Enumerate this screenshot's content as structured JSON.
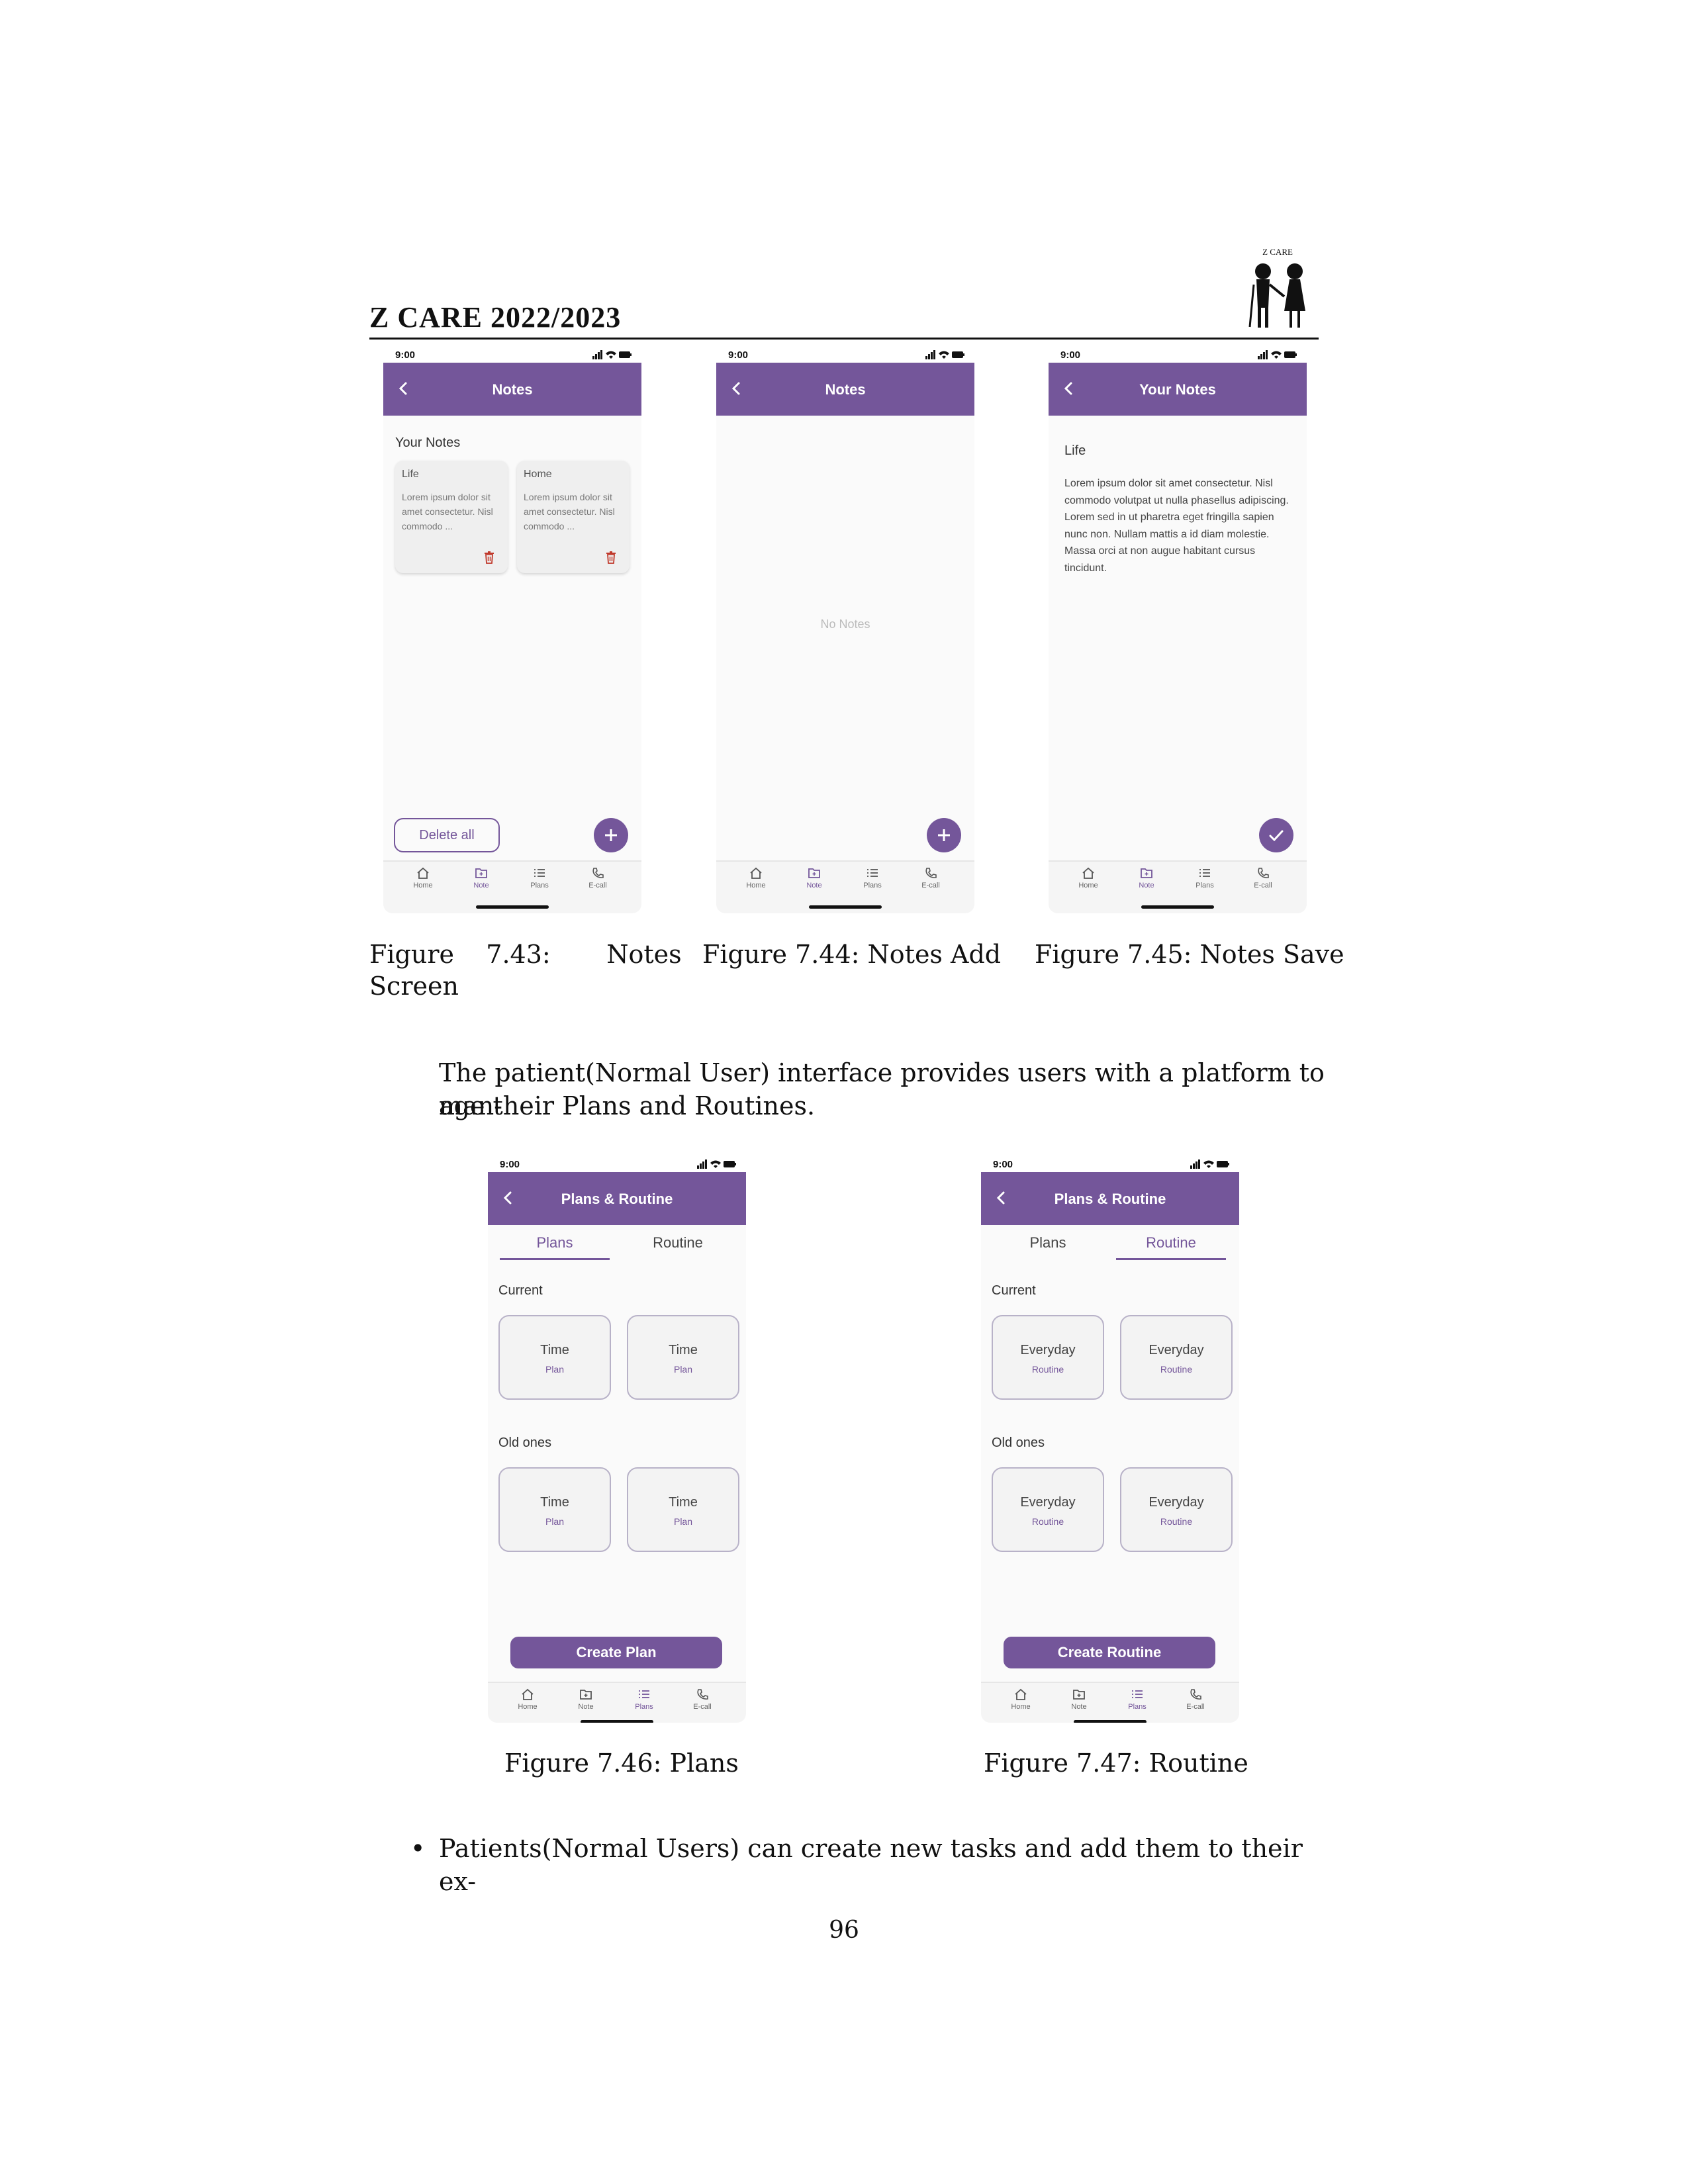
{
  "header": {
    "title": "Z CARE 2022/2023",
    "logo_text": "Z CARE"
  },
  "common": {
    "status_time": "9:00",
    "nav": [
      "Home",
      "Note",
      "Plans",
      "E-call"
    ]
  },
  "phone1": {
    "title": "Notes",
    "section": "Your Notes",
    "notes": [
      {
        "title": "Life",
        "body": "Lorem ipsum dolor sit amet consectetur. Nisl commodo ..."
      },
      {
        "title": "Home",
        "body": "Lorem ipsum dolor sit amet consectetur. Nisl commodo ..."
      }
    ],
    "delete_all": "Delete all",
    "active_nav": "Note"
  },
  "phone2": {
    "title": "Notes",
    "empty": "No Notes"
  },
  "phone3": {
    "title": "Your Notes",
    "note_title": "Life",
    "note_body": "Lorem ipsum dolor sit amet consectetur. Nisl commodo volutpat ut nulla phasellus adipiscing. Lorem sed in ut pharetra eget fringilla sapien nunc non. Nullam mattis a id diam molestie. Massa orci at non augue habitant cursus tincidunt."
  },
  "captions": {
    "c43a": "Figure    7.43:       Notes",
    "c43b": "Screen",
    "c44": "Figure 7.44: Notes Add",
    "c45": "Figure 7.45: Notes Save",
    "c46": "Figure 7.46: Plans",
    "c47": "Figure 7.47: Routine"
  },
  "paragraph": {
    "line1": "The patient(Normal User) interface provides users with a platform to man-",
    "line2": "age their Plans and Routines."
  },
  "phone4": {
    "title": "Plans & Routine",
    "tabs": [
      "Plans",
      "Routine"
    ],
    "current": "Current",
    "old": "Old ones",
    "card_title": "Time",
    "card_sub": "Plan",
    "button": "Create Plan"
  },
  "phone5": {
    "title": "Plans & Routine",
    "tabs": [
      "Plans",
      "Routine"
    ],
    "current": "Current",
    "old": "Old ones",
    "card_title": "Everyday",
    "card_sub": "Routine",
    "button": "Create Routine"
  },
  "bullet": "Patients(Normal Users) can create new tasks and add them to their ex-",
  "page_number": "96",
  "colors": {
    "accent": "#74569a",
    "danger": "#c0392b"
  }
}
